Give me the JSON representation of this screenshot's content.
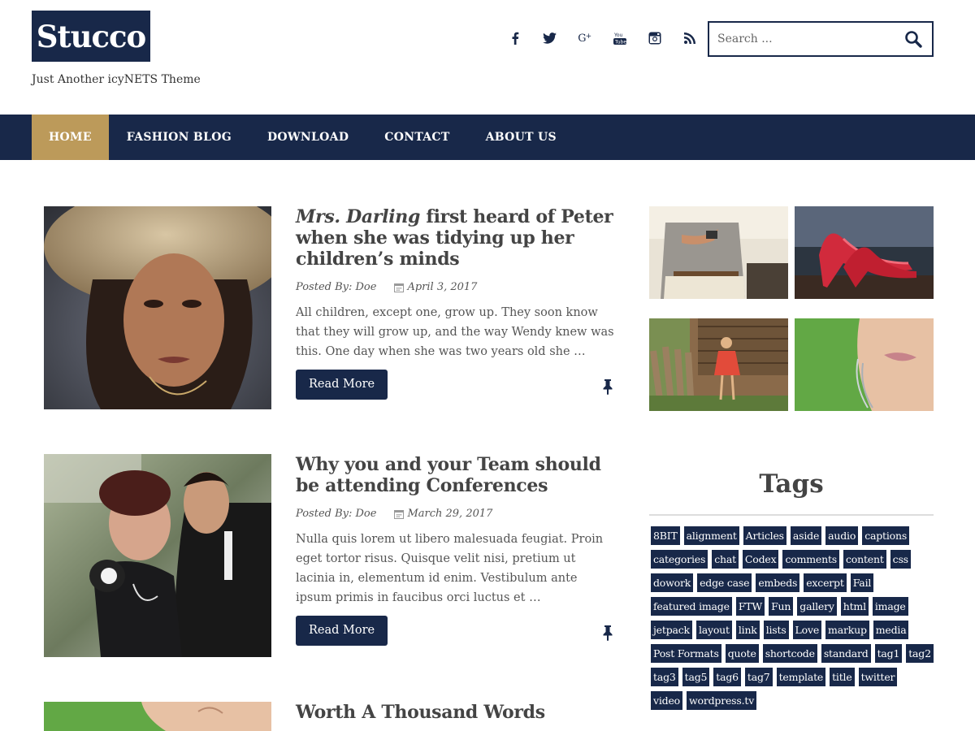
{
  "site": {
    "logo": "Stucco",
    "tagline": "Just Another icyNETS Theme"
  },
  "social_icons": [
    "facebook-icon",
    "twitter-icon",
    "google-plus-icon",
    "youtube-icon",
    "instagram-icon",
    "rss-icon"
  ],
  "search": {
    "placeholder": "Search ..."
  },
  "nav": {
    "items": [
      "HOME",
      "FASHION BLOG",
      "DOWNLOAD",
      "CONTACT",
      "ABOUT US"
    ],
    "active": "HOME"
  },
  "posts": [
    {
      "title_em": "Mrs. Darling",
      "title_rest": " first heard of Peter when she was tidying up her children’s minds",
      "author": "Posted By: Doe",
      "date": "April 3, 2017",
      "excerpt": "All children, except one, grow up. They soon know that they will grow up, and the way Wendy knew was this. One day when she was two years old she …",
      "read_more": "Read More"
    },
    {
      "title": "Why you and your Team should be attending Conferences",
      "author": "Posted By: Doe",
      "date": "March 29, 2017",
      "excerpt": "Nulla quis lorem ut libero malesuada feugiat. Proin eget tortor risus. Quisque velit nisi, pretium ut lacinia in, elementum id enim. Vestibulum ante ipsum primis in faucibus orci luctus et …",
      "read_more": "Read More"
    },
    {
      "title": "Worth A Thousand Words"
    }
  ],
  "sidebar": {
    "tags_title": "Tags",
    "tags": [
      [
        "8BIT",
        "alignment",
        "Articles",
        "aside",
        "audio",
        "captions"
      ],
      [
        "categories",
        "chat",
        "Codex",
        "comments",
        "content",
        "css"
      ],
      [
        "dowork",
        "edge case",
        "embeds",
        "excerpt",
        "Fail"
      ],
      [
        "featured image",
        "FTW",
        "Fun",
        "gallery",
        "html",
        "image"
      ],
      [
        "jetpack",
        "layout",
        "link",
        "lists",
        "Love",
        "markup",
        "media"
      ],
      [
        "Post Formats",
        "quote",
        "shortcode",
        "standard",
        "tag1",
        "tag2"
      ],
      [
        "tag3",
        "tag5",
        "tag6",
        "tag7",
        "template",
        "title",
        "twitter"
      ],
      [
        "video",
        "wordpress.tv"
      ]
    ]
  },
  "colors": {
    "navy": "#182849",
    "gold": "#bc9a5a"
  }
}
